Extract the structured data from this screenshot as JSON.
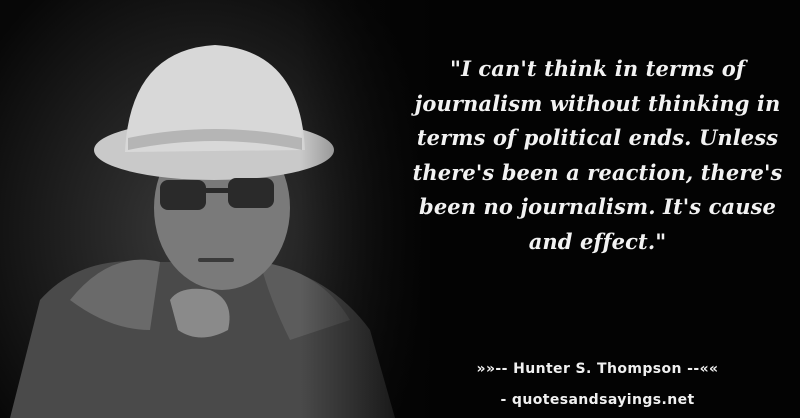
{
  "quote": {
    "text": "\"I can't think in terms of journalism without thinking in terms of political ends. Unless there's been a reaction, there's been no journalism. It's cause and effect.\""
  },
  "attribution": {
    "author": "»»-- Hunter S. Thompson --««",
    "site": "- quotesandsayings.net"
  },
  "colors": {
    "background": "#030303",
    "text": "#f2f2f2"
  }
}
